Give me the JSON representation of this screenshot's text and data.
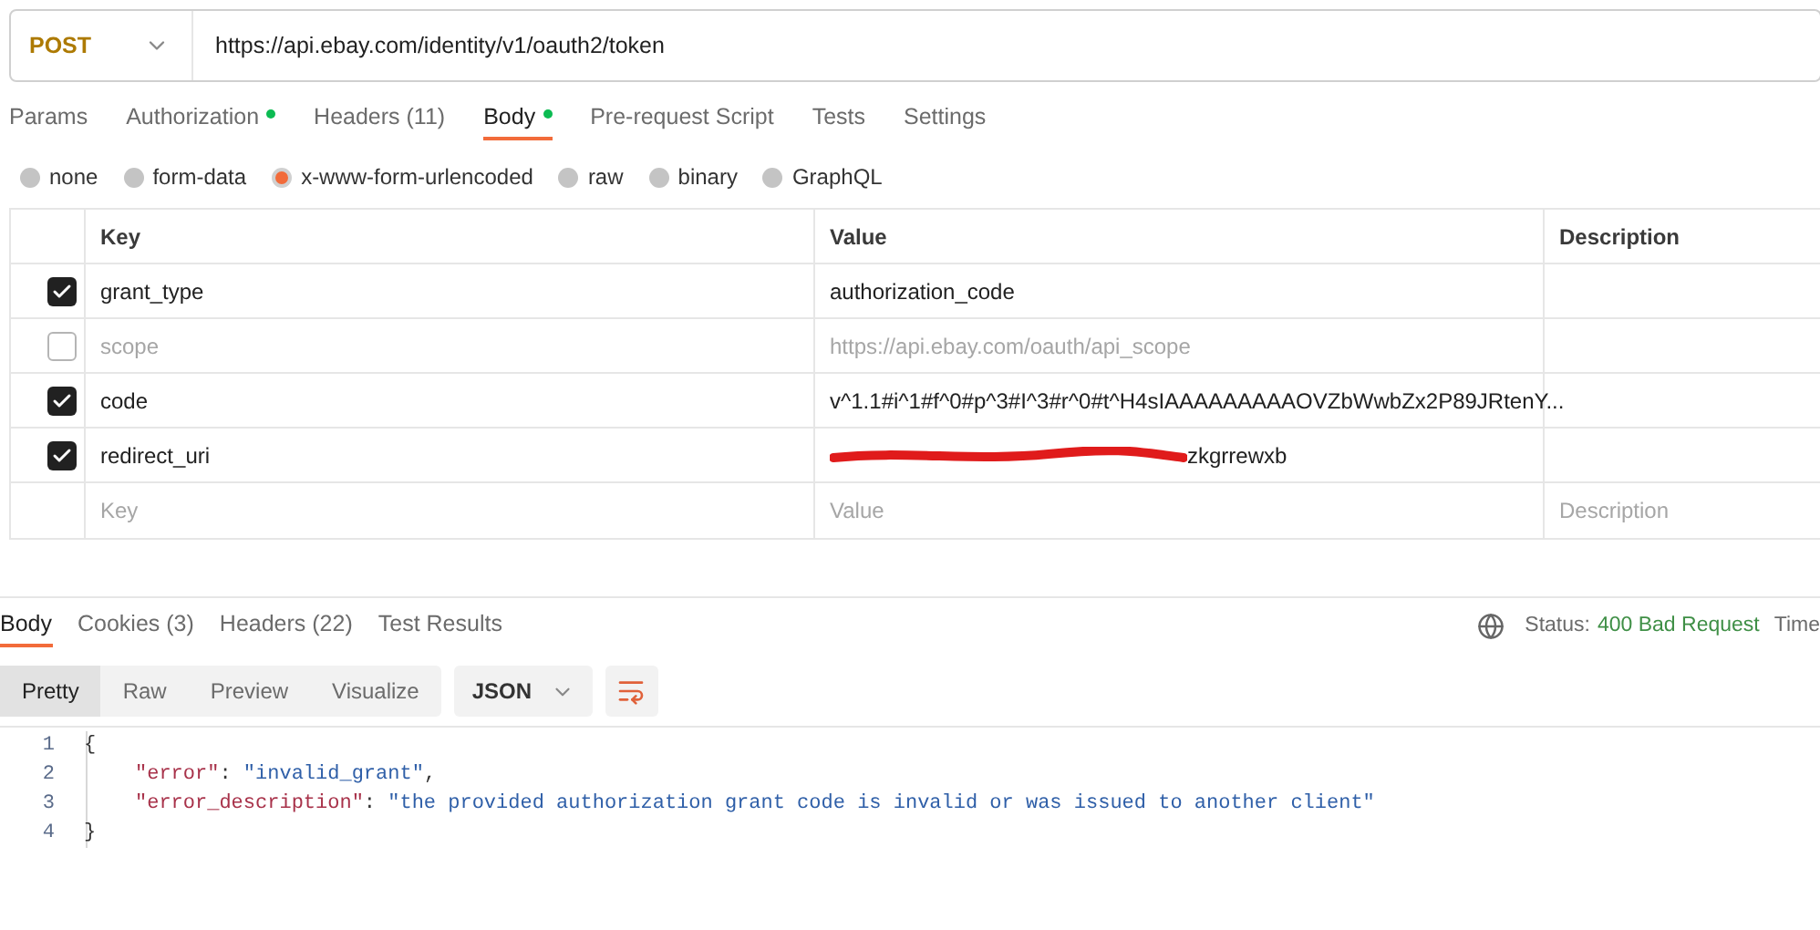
{
  "request": {
    "method": "POST",
    "url": "https://api.ebay.com/identity/v1/oauth2/token"
  },
  "request_tabs": [
    {
      "label": "Params",
      "selected": false,
      "dot": false
    },
    {
      "label": "Authorization",
      "selected": false,
      "dot": true
    },
    {
      "label": "Headers (11)",
      "selected": false,
      "dot": false
    },
    {
      "label": "Body",
      "selected": true,
      "dot": true
    },
    {
      "label": "Pre-request Script",
      "selected": false,
      "dot": false
    },
    {
      "label": "Tests",
      "selected": false,
      "dot": false
    },
    {
      "label": "Settings",
      "selected": false,
      "dot": false
    }
  ],
  "body_types": [
    {
      "label": "none",
      "selected": false
    },
    {
      "label": "form-data",
      "selected": false
    },
    {
      "label": "x-www-form-urlencoded",
      "selected": true
    },
    {
      "label": "raw",
      "selected": false
    },
    {
      "label": "binary",
      "selected": false
    },
    {
      "label": "GraphQL",
      "selected": false
    }
  ],
  "table": {
    "columns": [
      "Key",
      "Value",
      "Description"
    ],
    "rows": [
      {
        "checked": true,
        "key": "grant_type",
        "value": "authorization_code",
        "redacted": false
      },
      {
        "checked": false,
        "key": "scope",
        "value": "https://api.ebay.com/oauth/api_scope",
        "redacted": false
      },
      {
        "checked": true,
        "key": "code",
        "value": "v^1.1#i^1#f^0#p^3#I^3#r^0#t^H4sIAAAAAAAAAOVZbWwbZx2P89JRtenY...",
        "redacted": false
      },
      {
        "checked": true,
        "key": "redirect_uri",
        "value": "zkgrrewxb",
        "redacted": true
      }
    ],
    "new_row": {
      "key": "Key",
      "value": "Value",
      "description": "Description"
    }
  },
  "response_tabs": [
    {
      "label": "Body",
      "selected": true
    },
    {
      "label": "Cookies (3)",
      "selected": false
    },
    {
      "label": "Headers (22)",
      "selected": false
    },
    {
      "label": "Test Results",
      "selected": false
    }
  ],
  "status": {
    "label": "Status:",
    "value": "400 Bad Request",
    "time": "Time"
  },
  "view_modes": [
    {
      "label": "Pretty",
      "selected": true
    },
    {
      "label": "Raw",
      "selected": false
    },
    {
      "label": "Preview",
      "selected": false
    },
    {
      "label": "Visualize",
      "selected": false
    }
  ],
  "format": "JSON",
  "code_lines": [
    {
      "number": "1",
      "indent": false,
      "tokens": [
        {
          "kind": "punct",
          "text": "{"
        }
      ]
    },
    {
      "number": "2",
      "indent": true,
      "tokens": [
        {
          "kind": "key",
          "text": "\"error\""
        },
        {
          "kind": "punct",
          "text": ": "
        },
        {
          "kind": "string",
          "text": "\"invalid_grant\""
        },
        {
          "kind": "punct",
          "text": ","
        }
      ]
    },
    {
      "number": "3",
      "indent": true,
      "tokens": [
        {
          "kind": "key",
          "text": "\"error_description\""
        },
        {
          "kind": "punct",
          "text": ": "
        },
        {
          "kind": "string",
          "text": "\"the provided authorization grant code is invalid or was issued to another client\""
        }
      ]
    },
    {
      "number": "4",
      "indent": false,
      "tokens": [
        {
          "kind": "punct",
          "text": "}"
        }
      ]
    }
  ]
}
